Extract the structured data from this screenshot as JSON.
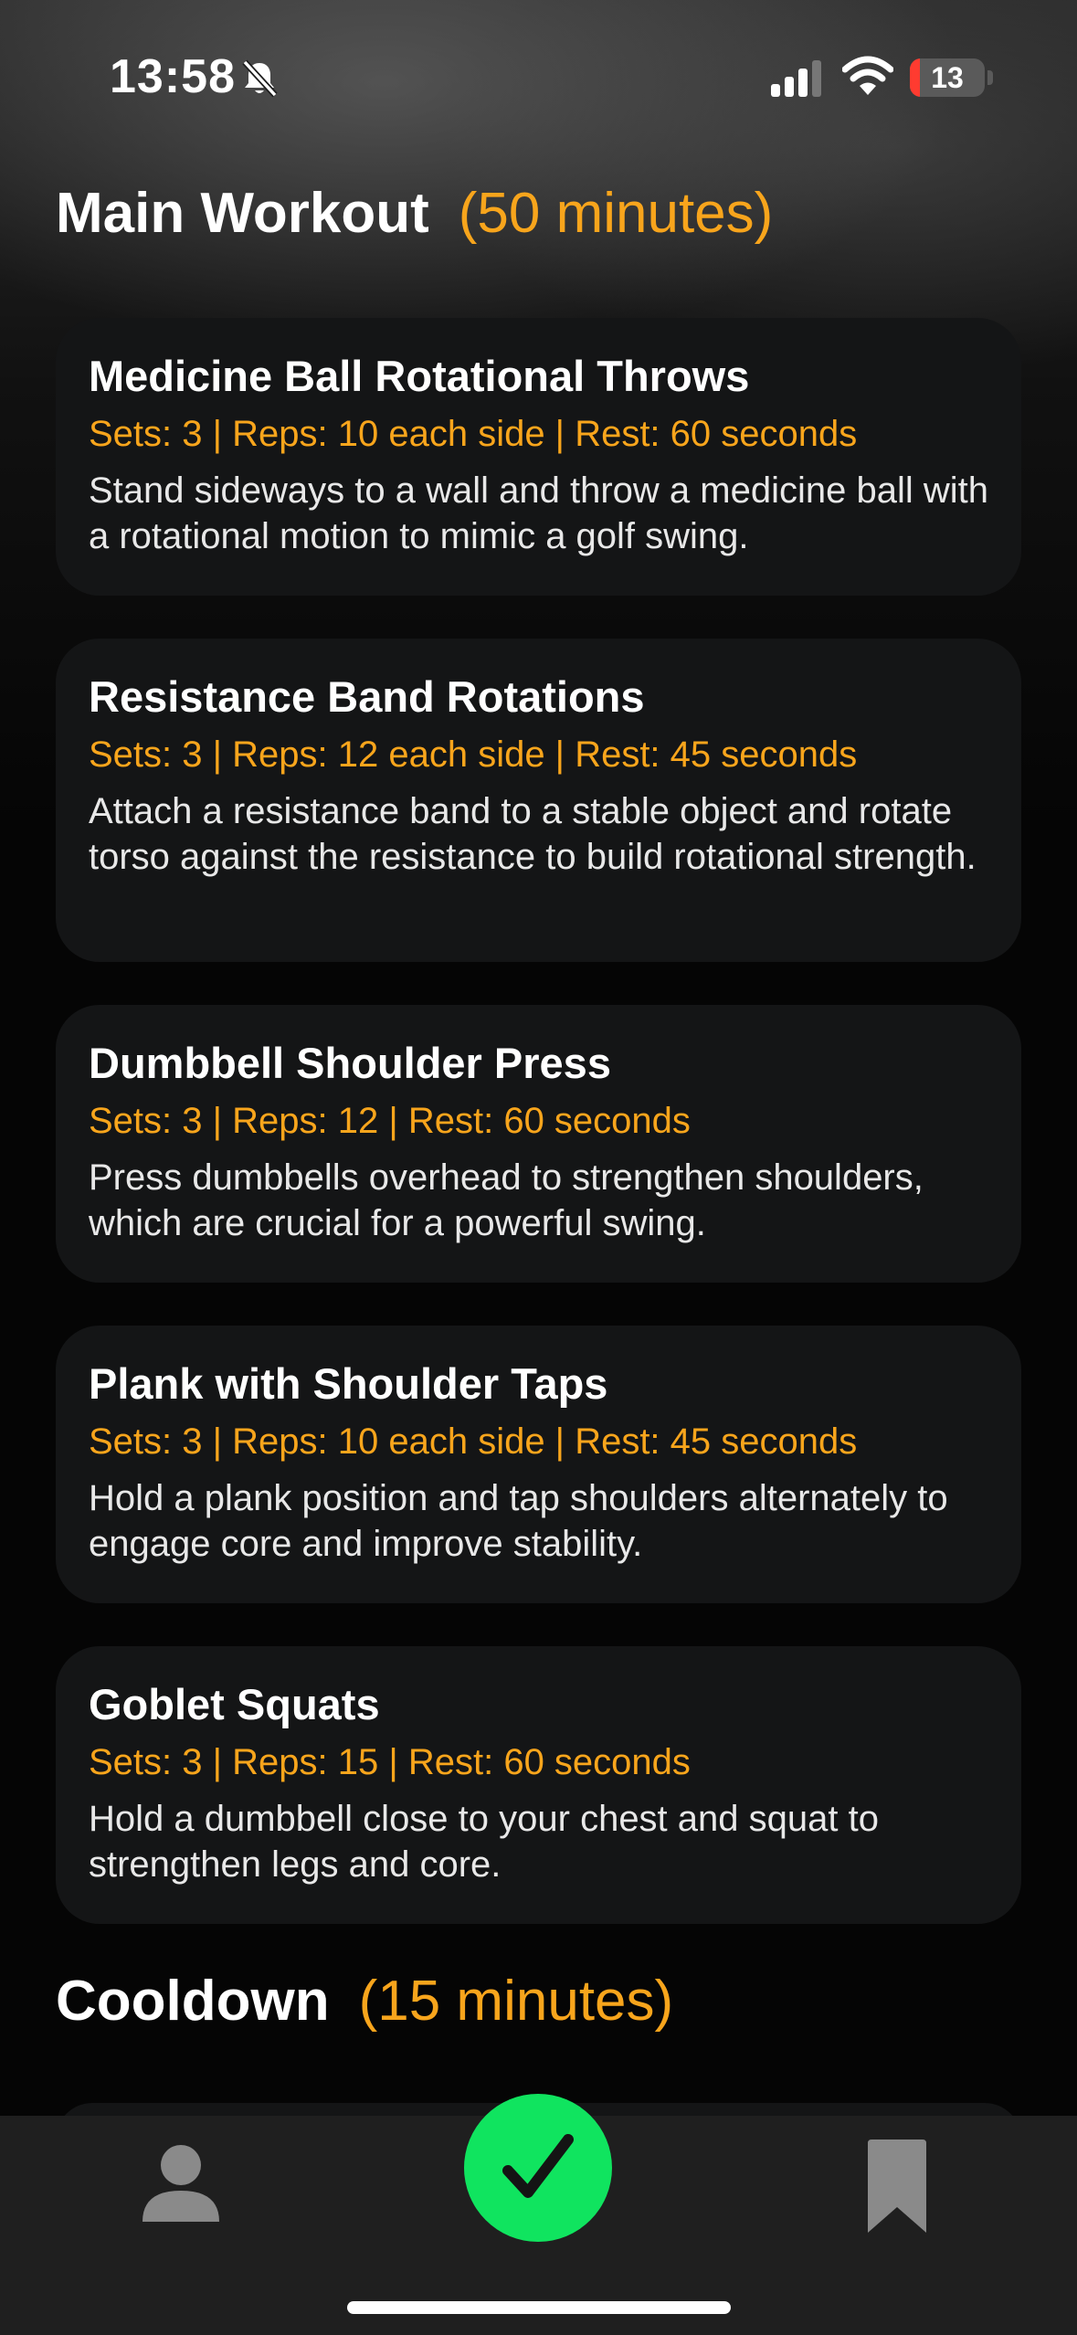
{
  "status_bar": {
    "time": "13:58",
    "battery_level": "13",
    "icons": [
      "bell-slash-icon",
      "cellular-signal-icon",
      "wifi-icon",
      "battery-icon"
    ]
  },
  "sections": {
    "main": {
      "title": "Main Workout",
      "duration": "(50 minutes)"
    },
    "cooldown": {
      "title": "Cooldown",
      "duration": "(15 minutes)"
    }
  },
  "exercises": [
    {
      "name": "Medicine Ball Rotational Throws",
      "meta": "Sets: 3 | Reps: 10 each side | Rest: 60 seconds",
      "description": "Stand sideways to a wall and throw a medicine ball with a rotational motion to mimic a golf swing."
    },
    {
      "name": "Resistance Band Rotations",
      "meta": "Sets: 3 | Reps: 12 each side | Rest: 45 seconds",
      "description": "Attach a resistance band to a stable object and rotate torso against the resistance to build rotational strength."
    },
    {
      "name": "Dumbbell Shoulder Press",
      "meta": "Sets: 3 | Reps: 12 | Rest: 60 seconds",
      "description": "Press dumbbells overhead to strengthen shoulders, which are crucial for a powerful swing."
    },
    {
      "name": "Plank with Shoulder Taps",
      "meta": "Sets: 3 | Reps: 10 each side | Rest: 45 seconds",
      "description": "Hold a plank position and tap shoulders alternately to engage core and improve stability."
    },
    {
      "name": "Goblet Squats",
      "meta": "Sets: 3 | Reps: 15 | Rest: 60 seconds",
      "description": "Hold a dumbbell close to your chest and squat to strengthen legs and core."
    }
  ],
  "tab_bar": {
    "icons": [
      "person-icon",
      "checkmark-icon",
      "bookmark-icon"
    ]
  },
  "colors": {
    "accent": "#f8a51c",
    "check_button": "#10e45f",
    "card_background": "#141516",
    "tab_bar_background": "#1f1f1f"
  }
}
